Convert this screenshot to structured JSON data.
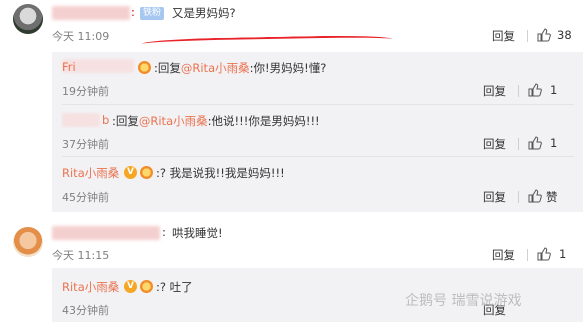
{
  "comments": [
    {
      "author": "",
      "badge": "铁粉",
      "text": "又是男妈妈?",
      "time": "今天 11:09",
      "reply_label": "回复",
      "likes": "38"
    },
    {
      "author": "",
      "text": "哄我睡觉!",
      "time": "今天 11:15",
      "reply_label": "回复",
      "likes": "1"
    }
  ],
  "replies": [
    {
      "author_suffix": "Fri",
      "prefix": "回复",
      "at": "@Rita小雨桑",
      "text": ":你!男妈妈!懂?",
      "time": "19分钟前",
      "reply_label": "回复",
      "likes": "1"
    },
    {
      "author_suffix": "b",
      "prefix": "回复",
      "at": "@Rita小雨桑",
      "text": ":他说!!!你是男妈妈!!!",
      "time": "37分钟前",
      "reply_label": "回复",
      "likes": "1"
    },
    {
      "author": "Rita小雨桑",
      "text": ":? 我是说我!!我是妈妈!!!",
      "time": "45分钟前",
      "reply_label": "回复",
      "likes": "赞"
    },
    {
      "author": "Rita小雨桑",
      "text": ":? 吐了",
      "time": "43分钟前",
      "reply_label": "回复"
    }
  ],
  "watermark": "企鹅号 瑞雪说游戏",
  "colors": {
    "link": "#eb7350",
    "annotation": "#e8242a",
    "panel": "#f2f2f5"
  }
}
